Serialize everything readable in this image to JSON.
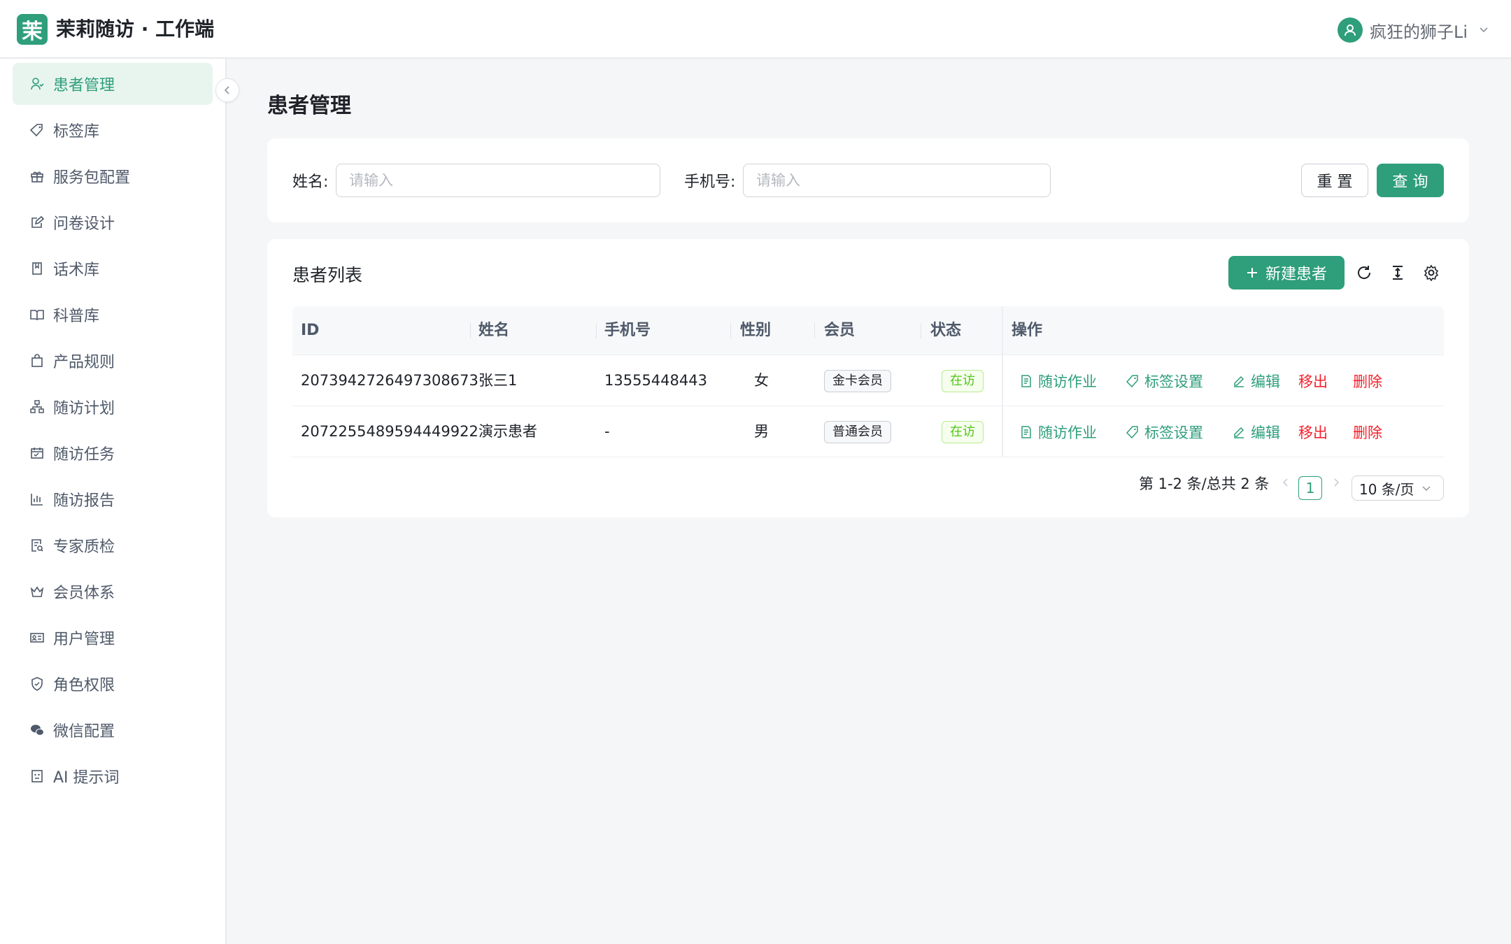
{
  "app": {
    "logo_char": "茉",
    "title": "茉莉随访 · 工作端",
    "brand_color": "#2e9e7b"
  },
  "user": {
    "name": "疯狂的狮子Li"
  },
  "sidebar": {
    "items": [
      {
        "label": "患者管理",
        "icon": "patient-icon",
        "active": true
      },
      {
        "label": "标签库",
        "icon": "tag-icon",
        "active": false
      },
      {
        "label": "服务包配置",
        "icon": "gift-icon",
        "active": false
      },
      {
        "label": "问卷设计",
        "icon": "edit-icon",
        "active": false
      },
      {
        "label": "话术库",
        "icon": "book-icon",
        "active": false
      },
      {
        "label": "科普库",
        "icon": "open-book-icon",
        "active": false
      },
      {
        "label": "产品规则",
        "icon": "bag-icon",
        "active": false
      },
      {
        "label": "随访计划",
        "icon": "hierarchy-icon",
        "active": false
      },
      {
        "label": "随访任务",
        "icon": "calendar-icon",
        "active": false
      },
      {
        "label": "随访报告",
        "icon": "bar-chart-icon",
        "active": false
      },
      {
        "label": "专家质检",
        "icon": "inspect-icon",
        "active": false
      },
      {
        "label": "会员体系",
        "icon": "crown-icon",
        "active": false
      },
      {
        "label": "用户管理",
        "icon": "id-card-icon",
        "active": false
      },
      {
        "label": "角色权限",
        "icon": "shield-icon",
        "active": false
      },
      {
        "label": "微信配置",
        "icon": "wechat-icon",
        "active": false
      },
      {
        "label": "AI 提示词",
        "icon": "robot-icon",
        "active": false
      }
    ]
  },
  "page": {
    "title": "患者管理"
  },
  "search": {
    "name_label": "姓名:",
    "name_placeholder": "请输入",
    "phone_label": "手机号:",
    "phone_placeholder": "请输入",
    "reset_label": "重 置",
    "query_label": "查 询"
  },
  "list": {
    "title": "患者列表",
    "new_label": "新建患者",
    "columns": [
      "ID",
      "姓名",
      "手机号",
      "性别",
      "会员",
      "状态",
      "操作"
    ],
    "rows": [
      {
        "id": "2073942726497308673",
        "name": "张三1",
        "phone": "13555448443",
        "gender": "女",
        "member": "金卡会员",
        "status": "在访"
      },
      {
        "id": "2072255489594449922",
        "name": "演示患者",
        "phone": "-",
        "gender": "男",
        "member": "普通会员",
        "status": "在访"
      }
    ],
    "actions": {
      "followup": "随访作业",
      "tags": "标签设置",
      "edit": "编辑",
      "remove": "移出",
      "delete": "删除"
    }
  },
  "pagination": {
    "total_text": "第 1-2 条/总共 2 条",
    "current_page": "1",
    "page_size": "10 条/页"
  }
}
